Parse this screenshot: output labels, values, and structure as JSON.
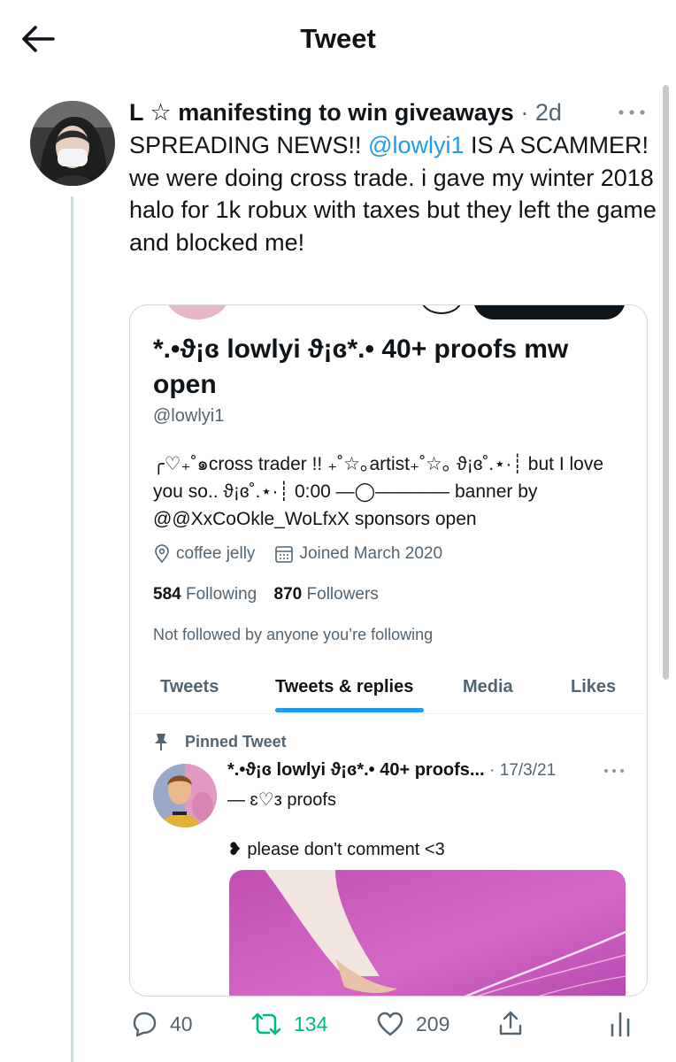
{
  "header": {
    "title": "Tweet",
    "back_icon": "arrow-left-icon"
  },
  "tweet": {
    "author_name": "L ☆ manifesting to win giveaways",
    "timestamp": "· 2d",
    "text_prefix": "SPREADING NEWS!! ",
    "mention": "@lowlyi1",
    "text_line1_suffix": " IS A SCAMMER!",
    "text_line2": "we were doing cross trade. i gave my winter 2018 halo for 1k robux with taxes but they left the game and blocked me!"
  },
  "card": {
    "profile_name": "*.•ϑ¡ɞ lowlyi ϑ¡ɞ*.• 40+ proofs mw open",
    "handle": "@lowlyi1",
    "bio": "╭♡₊˚๑cross trader !! ₊˚☆｡artist₊˚☆｡ ϑ¡ɞ˚.⋆·┊ but I love you so.. ϑ¡ɞ˚.⋆·┊ 0:00 —◯———— banner by @@XxCoOkle_WoLfxX sponsors open",
    "location": "coffee jelly",
    "joined": "Joined March 2020",
    "following_count": "584",
    "following_label": "Following",
    "followers_count": "870",
    "followers_label": "Followers",
    "not_followed": "Not followed by anyone you’re following",
    "tabs": [
      {
        "label": "Tweets"
      },
      {
        "label": "Tweets & replies"
      },
      {
        "label": "Media"
      },
      {
        "label": "Likes"
      }
    ],
    "active_tab": "Tweets & replies",
    "pinned_label": "Pinned Tweet",
    "pinned_author": "*.•ϑ¡ɞ lowlyi ϑ¡ɞ*.• 40+ proofs...",
    "pinned_date": "· 17/3/21",
    "pinned_sub": "— ɛ♡з proofs",
    "pinned_text": "❥ please don't comment <3"
  },
  "actions": {
    "replies": "40",
    "retweets": "134",
    "likes": "209"
  },
  "colors": {
    "link": "#1d9bf0",
    "retweet": "#00ba7c",
    "secondary_text": "#536471",
    "border": "#cfd9de"
  }
}
